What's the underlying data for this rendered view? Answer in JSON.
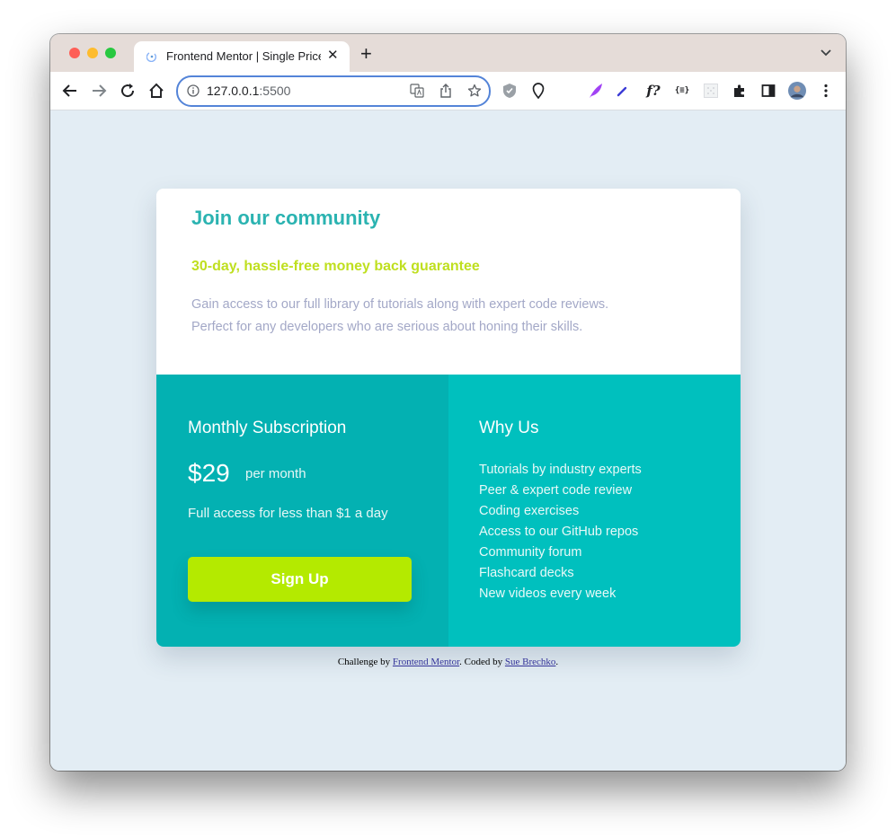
{
  "browser": {
    "tab_title": "Frontend Mentor | Single Price",
    "new_tab_label": "+",
    "close_label": "✕",
    "url_host": "127.0.0.1",
    "url_port": ":5500"
  },
  "card": {
    "heading": "Join our community",
    "guarantee": "30-day, hassle-free money back guarantee",
    "description_line1": "Gain access to our full library of tutorials along with expert code reviews.",
    "description_line2": "Perfect for any developers who are serious about honing their skills."
  },
  "subscription": {
    "title": "Monthly Subscription",
    "price": "$29",
    "period": "per month",
    "access": "Full access for less than $1 a day",
    "button_label": "Sign Up"
  },
  "why_us": {
    "title": "Why Us",
    "items": [
      "Tutorials by industry experts",
      "Peer & expert code review",
      "Coding exercises",
      "Access to our GitHub repos",
      "Community forum",
      "Flashcard decks",
      "New videos every week"
    ]
  },
  "footer": {
    "challenge_prefix": "Challenge by ",
    "challenge_link": "Frontend Mentor",
    "coded_prefix": ". Coded by ",
    "coded_link": "Sue Brechko",
    "suffix": "."
  },
  "colors": {
    "heading": "#2bb3b1",
    "guarantee": "#bfdf1f",
    "left_column": "#03b1b2",
    "right_column": "#00c0be",
    "button": "#b4ea00",
    "page_background": "#e3edf4"
  },
  "icons": {
    "toolbar": [
      "back-icon",
      "forward-icon",
      "reload-icon",
      "home-icon",
      "info-icon",
      "translate-icon",
      "share-icon",
      "star-icon",
      "shield-icon",
      "location-icon",
      "feather-icon",
      "pen-icon",
      "font-icon",
      "json-icon",
      "grid-icon",
      "extensions-icon",
      "sidebar-icon",
      "avatar",
      "menu-icon"
    ]
  }
}
